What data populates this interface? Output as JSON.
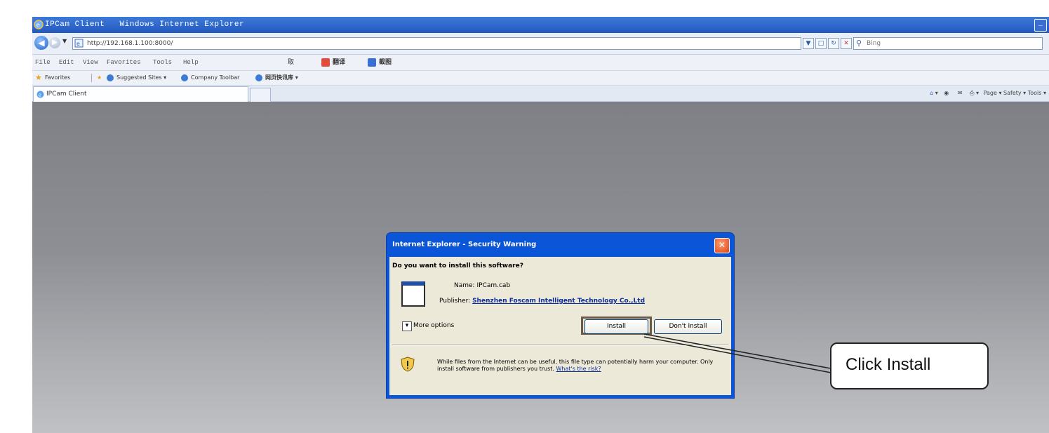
{
  "window": {
    "title": "IPCam Client   Windows Internet Explorer"
  },
  "address_bar": {
    "url": "http://192.168.1.100:8000/",
    "search_placeholder": "Bing"
  },
  "menu": {
    "items": [
      "File",
      "Edit",
      "View",
      "Favorites",
      "Tools",
      "Help"
    ],
    "toolbar_item": "翻译",
    "toolbar_item2": "截图"
  },
  "favorites": {
    "label": "Favorites",
    "items": [
      "Suggested Sites ▾",
      "Company Toolbar",
      "网页快讯库 ▾"
    ]
  },
  "tab": {
    "title": "IPCam Client",
    "command_bar": "Page ▾  Safety ▾  Tools ▾"
  },
  "dialog": {
    "title": "Internet Explorer - Security Warning",
    "question": "Do you want to install this software?",
    "name_label": "Name:",
    "name_value": "IPCam.cab",
    "publisher_label": "Publisher:",
    "publisher_value": "Shenzhen Foscam Intelligent Technology Co.,Ltd",
    "more_options": "More options",
    "install_label": "Install",
    "dont_install_label": "Don't Install",
    "warning_text": "While files from the Internet can be useful, this file type can potentially harm your computer. Only install software from publishers you trust.",
    "warning_link": "What's the risk?"
  },
  "callout": {
    "text": "Click Install"
  },
  "colors": {
    "titlebar": "#2458c0",
    "dialog_frame": "#0a55d8",
    "dialog_body": "#ece9d8",
    "content_bg": "#8d8f94"
  }
}
